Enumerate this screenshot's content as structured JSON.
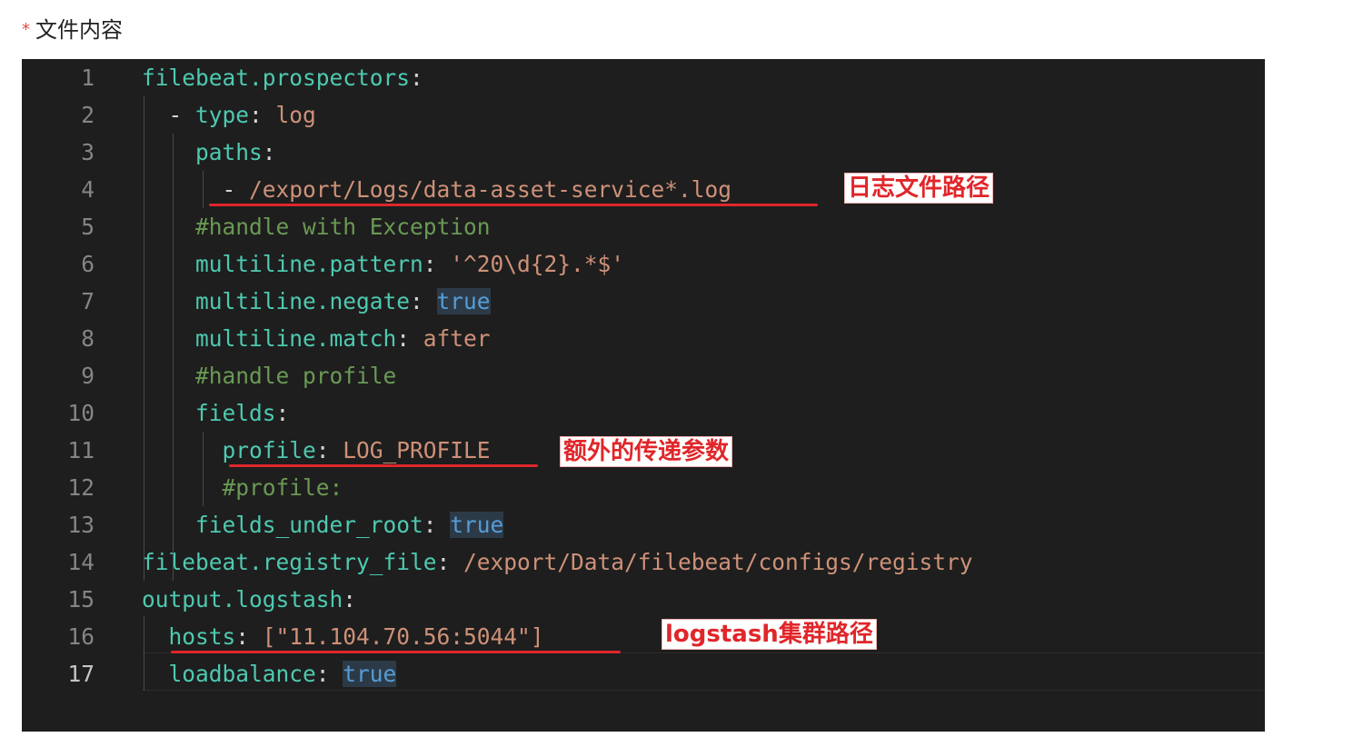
{
  "field": {
    "required_mark": "*",
    "label": "文件内容"
  },
  "editor": {
    "lines": [
      {
        "num": "1",
        "tokens": [
          {
            "t": "filebeat.prospectors",
            "c": "key"
          },
          {
            "t": ":",
            "c": "punct"
          }
        ]
      },
      {
        "num": "2",
        "tokens": [
          {
            "t": "  - ",
            "c": "punct"
          },
          {
            "t": "type",
            "c": "key"
          },
          {
            "t": ": ",
            "c": "punct"
          },
          {
            "t": "log",
            "c": "str"
          }
        ]
      },
      {
        "num": "3",
        "tokens": [
          {
            "t": "    paths",
            "c": "key"
          },
          {
            "t": ":",
            "c": "punct"
          }
        ]
      },
      {
        "num": "4",
        "tokens": [
          {
            "t": "      - ",
            "c": "punct"
          },
          {
            "t": "/export/Logs/data-asset-service*.log",
            "c": "str"
          }
        ]
      },
      {
        "num": "5",
        "tokens": [
          {
            "t": "    #handle with Exception",
            "c": "comment"
          }
        ]
      },
      {
        "num": "6",
        "tokens": [
          {
            "t": "    multiline.pattern",
            "c": "key"
          },
          {
            "t": ": ",
            "c": "punct"
          },
          {
            "t": "'^20\\d{2}.*$'",
            "c": "str"
          }
        ]
      },
      {
        "num": "7",
        "tokens": [
          {
            "t": "    multiline.negate",
            "c": "key"
          },
          {
            "t": ": ",
            "c": "punct"
          },
          {
            "t": "true",
            "c": "bool"
          }
        ]
      },
      {
        "num": "8",
        "tokens": [
          {
            "t": "    multiline.match",
            "c": "key"
          },
          {
            "t": ": ",
            "c": "punct"
          },
          {
            "t": "after",
            "c": "str"
          }
        ]
      },
      {
        "num": "9",
        "tokens": [
          {
            "t": "    #handle profile",
            "c": "comment"
          }
        ]
      },
      {
        "num": "10",
        "tokens": [
          {
            "t": "    fields",
            "c": "key"
          },
          {
            "t": ":",
            "c": "punct"
          }
        ]
      },
      {
        "num": "11",
        "tokens": [
          {
            "t": "      profile",
            "c": "key"
          },
          {
            "t": ": ",
            "c": "punct"
          },
          {
            "t": "LOG_PROFILE",
            "c": "str"
          }
        ]
      },
      {
        "num": "12",
        "tokens": [
          {
            "t": "      #profile:",
            "c": "comment"
          }
        ]
      },
      {
        "num": "13",
        "tokens": [
          {
            "t": "    fields_under_root",
            "c": "key"
          },
          {
            "t": ": ",
            "c": "punct"
          },
          {
            "t": "true",
            "c": "bool"
          }
        ]
      },
      {
        "num": "14",
        "tokens": [
          {
            "t": "filebeat.registry_file",
            "c": "key"
          },
          {
            "t": ": ",
            "c": "punct"
          },
          {
            "t": "/export/Data/filebeat/configs/registry",
            "c": "str"
          }
        ]
      },
      {
        "num": "15",
        "tokens": [
          {
            "t": "output.logstash",
            "c": "key"
          },
          {
            "t": ":",
            "c": "punct"
          }
        ]
      },
      {
        "num": "16",
        "tokens": [
          {
            "t": "  hosts",
            "c": "key"
          },
          {
            "t": ": ",
            "c": "punct"
          },
          {
            "t": "[\"11.104.70.56:5044\"]",
            "c": "str"
          }
        ]
      },
      {
        "num": "17",
        "tokens": [
          {
            "t": "  loadbalance",
            "c": "key"
          },
          {
            "t": ": ",
            "c": "punct"
          },
          {
            "t": "true",
            "c": "bool"
          }
        ],
        "active": true
      }
    ]
  },
  "annotations": {
    "log_path": "日志文件路径",
    "extra_params": "额外的传递参数",
    "logstash_cluster": "logstash集群路径"
  },
  "colors": {
    "editor_bg": "#1e1e1e",
    "key": "#4ec9b0",
    "string": "#ce9178",
    "comment": "#6a9955",
    "boolean": "#569cd6",
    "annotation_red": "#e0262a",
    "required_red": "#e0484a"
  }
}
